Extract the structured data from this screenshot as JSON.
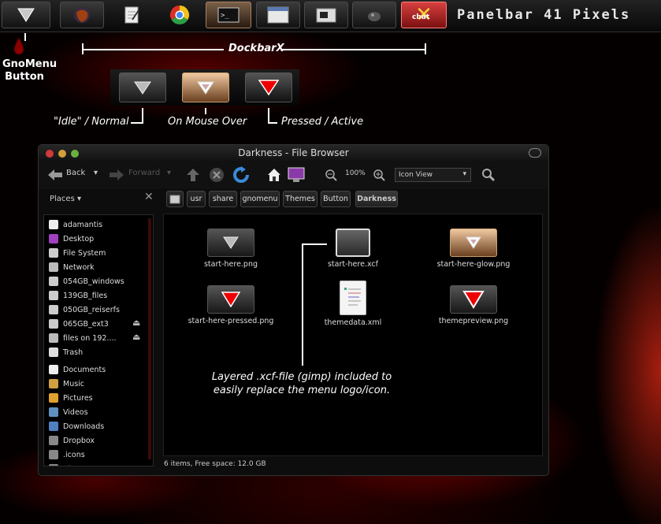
{
  "panel": {
    "title": "Panelbar 41 Pixels",
    "launchers": [
      {
        "name": "gnomenu-launcher",
        "icon": "triangle-down-icon"
      },
      {
        "name": "firefox-launcher",
        "icon": "firefox-icon"
      },
      {
        "name": "text-editor-launcher",
        "icon": "notepad-icon"
      },
      {
        "name": "chrome-launcher",
        "icon": "chrome-icon"
      },
      {
        "name": "terminal-launcher",
        "icon": "terminal-icon"
      },
      {
        "name": "window-launcher",
        "icon": "window-icon"
      },
      {
        "name": "file-manager-launcher",
        "icon": "folder-icon"
      },
      {
        "name": "gimp-launcher",
        "icon": "gimp-icon"
      },
      {
        "name": "chat-launcher",
        "icon": "chat-x-icon",
        "label": "chat"
      }
    ]
  },
  "annotations": {
    "gnomenu_line1": "GnoMenu",
    "gnomenu_line2": "Button",
    "dockbarx": "DockbarX",
    "idle": "\"Idle\" / Normal",
    "mouse_over": "On Mouse Over",
    "pressed": "Pressed / Active",
    "xcf_line1": "Layered .xcf-file (gimp) included to",
    "xcf_line2": "easily replace the menu logo/icon."
  },
  "browser": {
    "title": "Darkness - File Browser",
    "toolbar": {
      "back": "Back",
      "forward": "Forward",
      "zoom": "100%",
      "view": "Icon View"
    },
    "sidebar": {
      "header": "Places",
      "items": [
        {
          "label": "adamantis",
          "icon": "home-icon"
        },
        {
          "label": "Desktop",
          "icon": "desktop-icon"
        },
        {
          "label": "File System",
          "icon": "drive-icon"
        },
        {
          "label": "Network",
          "icon": "network-icon"
        },
        {
          "label": "054GB_windows",
          "icon": "drive-icon"
        },
        {
          "label": "139GB_files",
          "icon": "drive-icon"
        },
        {
          "label": "050GB_reiserfs",
          "icon": "drive-icon"
        },
        {
          "label": "065GB_ext3",
          "icon": "drive-icon",
          "eject": true
        },
        {
          "label": "files on 192....",
          "icon": "network-icon",
          "eject": true
        },
        {
          "label": "Trash",
          "icon": "trash-icon"
        },
        {
          "label": "Documents",
          "icon": "documents-icon"
        },
        {
          "label": "Music",
          "icon": "music-icon"
        },
        {
          "label": "Pictures",
          "icon": "pictures-icon"
        },
        {
          "label": "Videos",
          "icon": "videos-icon"
        },
        {
          "label": "Downloads",
          "icon": "downloads-icon"
        },
        {
          "label": "Dropbox",
          "icon": "folder-icon"
        },
        {
          "label": ".icons",
          "icon": "folder-icon"
        },
        {
          "label": ".themes",
          "icon": "folder-icon"
        }
      ]
    },
    "path": [
      "usr",
      "share",
      "gnomenu",
      "Themes",
      "Button",
      "Darkness"
    ],
    "files": [
      {
        "name": "start-here.png",
        "icon": "triangle-gray-icon"
      },
      {
        "name": "start-here.xcf",
        "icon": "xcf-icon"
      },
      {
        "name": "start-here-glow.png",
        "icon": "triangle-glow-icon"
      },
      {
        "name": "start-here-pressed.png",
        "icon": "triangle-red-icon"
      },
      {
        "name": "themedata.xml",
        "icon": "xml-file-icon"
      },
      {
        "name": "themepreview.png",
        "icon": "triangle-red-outline-icon"
      }
    ],
    "status": "6 items, Free space: 12.0 GB"
  }
}
